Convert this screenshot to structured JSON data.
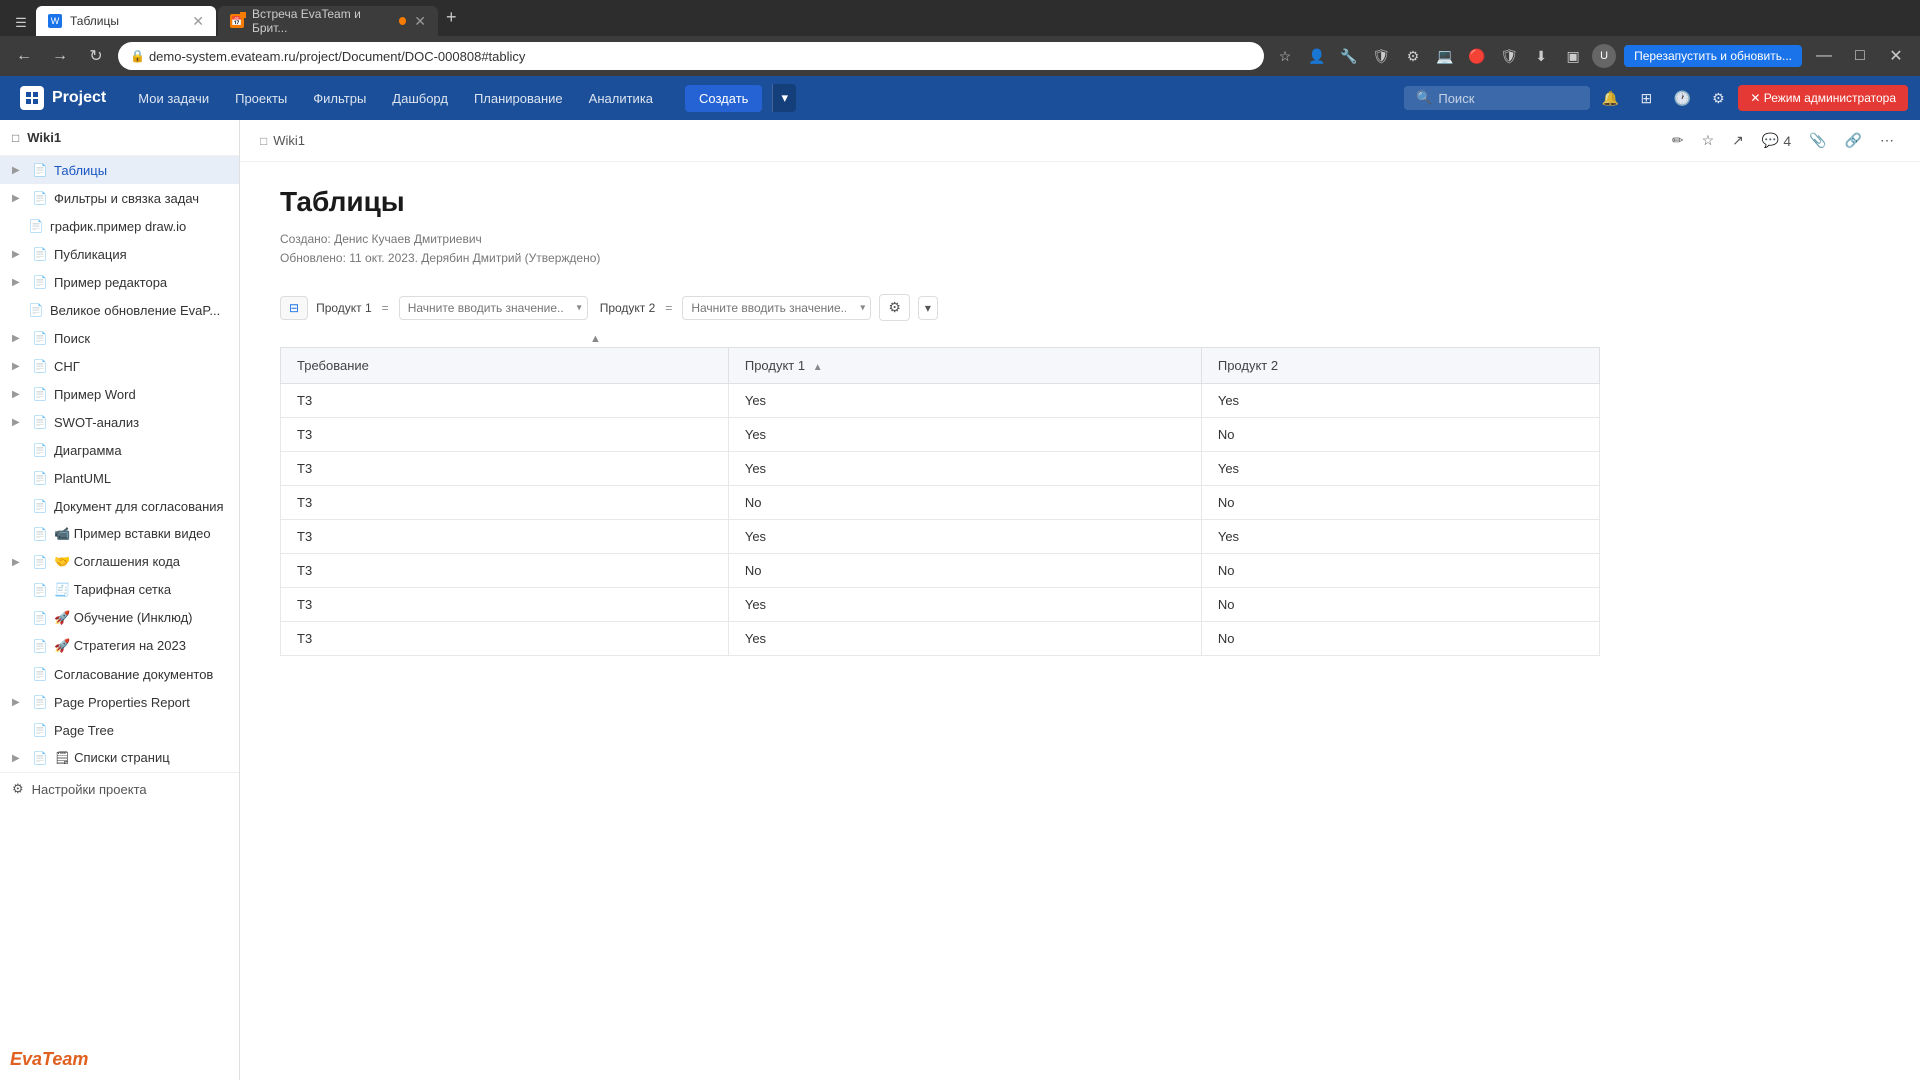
{
  "browser": {
    "tabs": [
      {
        "id": "tab1",
        "title": "Таблицы",
        "active": true,
        "favicon_color": "blue"
      },
      {
        "id": "tab2",
        "title": "Встреча EvaTeam и Брит...",
        "active": false,
        "favicon_color": "orange"
      }
    ],
    "url": "demo-system.evateam.ru/project/Document/DOC-000808#tablicy",
    "restart_label": "Перезапустить и обновить..."
  },
  "nav": {
    "logo": "Project",
    "items": [
      "Мои задачи",
      "Проекты",
      "Фильтры",
      "Дашборд",
      "Планирование",
      "Аналитика"
    ],
    "create_label": "Создать",
    "search_placeholder": "Поиск",
    "admin_mode": "✕ Режим администратора"
  },
  "sidebar": {
    "wiki_title": "Wiki1",
    "items": [
      {
        "label": "Таблицы",
        "active": true,
        "has_arrow": true,
        "indent": 0,
        "icon": "doc"
      },
      {
        "label": "Фильтры и связка задач",
        "active": false,
        "has_arrow": true,
        "indent": 0,
        "icon": "doc"
      },
      {
        "label": "график.пример draw.io",
        "active": false,
        "has_arrow": false,
        "indent": 1,
        "icon": "doc"
      },
      {
        "label": "Публикация",
        "active": false,
        "has_arrow": true,
        "indent": 0,
        "icon": "doc"
      },
      {
        "label": "Пример редактора",
        "active": false,
        "has_arrow": true,
        "indent": 0,
        "icon": "doc"
      },
      {
        "label": "Великое обновление EvaP...",
        "active": false,
        "has_arrow": false,
        "indent": 1,
        "icon": "doc"
      },
      {
        "label": "Поиск",
        "active": false,
        "has_arrow": true,
        "indent": 0,
        "icon": "doc"
      },
      {
        "label": "СНГ",
        "active": false,
        "has_arrow": true,
        "indent": 0,
        "icon": "doc"
      },
      {
        "label": "Пример Word",
        "active": false,
        "has_arrow": true,
        "indent": 0,
        "icon": "doc"
      },
      {
        "label": "SWOT-анализ",
        "active": false,
        "has_arrow": true,
        "indent": 0,
        "icon": "doc"
      },
      {
        "label": "Диаграмма",
        "active": false,
        "has_arrow": false,
        "indent": 0,
        "icon": "doc"
      },
      {
        "label": "PlantUML",
        "active": false,
        "has_arrow": false,
        "indent": 0,
        "icon": "doc"
      },
      {
        "label": "Документ для согласования",
        "active": false,
        "has_arrow": false,
        "indent": 0,
        "icon": "doc"
      },
      {
        "label": "📹 Пример вставки видео",
        "active": false,
        "has_arrow": false,
        "indent": 0,
        "icon": "doc"
      },
      {
        "label": "🤝 Соглашения кода",
        "active": false,
        "has_arrow": true,
        "indent": 0,
        "icon": "doc"
      },
      {
        "label": "🧾 Тарифная сетка",
        "active": false,
        "has_arrow": false,
        "indent": 0,
        "icon": "doc"
      },
      {
        "label": "🚀 Обучение (Инклюд)",
        "active": false,
        "has_arrow": false,
        "indent": 0,
        "icon": "doc"
      },
      {
        "label": "🚀 Стратегия на 2023",
        "active": false,
        "has_arrow": false,
        "indent": 0,
        "icon": "doc"
      },
      {
        "label": "Согласование документов",
        "active": false,
        "has_arrow": false,
        "indent": 0,
        "icon": "doc"
      },
      {
        "label": "Page Properties Report",
        "active": false,
        "has_arrow": true,
        "indent": 0,
        "icon": "doc"
      },
      {
        "label": "Page Tree",
        "active": false,
        "has_arrow": false,
        "indent": 0,
        "icon": "doc"
      },
      {
        "label": "🗒 Списки страниц",
        "active": false,
        "has_arrow": true,
        "indent": 0,
        "icon": "doc"
      }
    ],
    "settings_label": "Настройки проекта"
  },
  "page": {
    "breadcrumb": "Wiki1",
    "title": "Таблицы",
    "meta_created": "Создано: Денис Кучаев Дмитриевич",
    "meta_updated": "Обновлено: 11 окт. 2023. Дерябин Дмитрий  (Утверждено)",
    "action_count": "4"
  },
  "filter": {
    "product1_label": "Продукт 1",
    "eq1": "=",
    "placeholder1": "Начните вводить значение...",
    "product2_label": "Продукт 2",
    "eq2": "=",
    "placeholder2": "Начните вводить значение..."
  },
  "table": {
    "columns": [
      {
        "label": "Требование",
        "sortable": false
      },
      {
        "label": "Продукт 1",
        "sortable": true
      },
      {
        "label": "Продукт 2",
        "sortable": false
      }
    ],
    "rows": [
      {
        "req": "Т3",
        "prod1": "Yes",
        "prod2": "Yes"
      },
      {
        "req": "Т3",
        "prod1": "Yes",
        "prod2": "No"
      },
      {
        "req": "Т3",
        "prod1": "Yes",
        "prod2": "Yes"
      },
      {
        "req": "Т3",
        "prod1": "No",
        "prod2": "No"
      },
      {
        "req": "Т3",
        "prod1": "Yes",
        "prod2": "Yes"
      },
      {
        "req": "Т3",
        "prod1": "No",
        "prod2": "No"
      },
      {
        "req": "Т3",
        "prod1": "Yes",
        "prod2": "No"
      },
      {
        "req": "Т3",
        "prod1": "Yes",
        "prod2": "No"
      }
    ]
  },
  "footer": {
    "logo": "EvaTeam"
  }
}
